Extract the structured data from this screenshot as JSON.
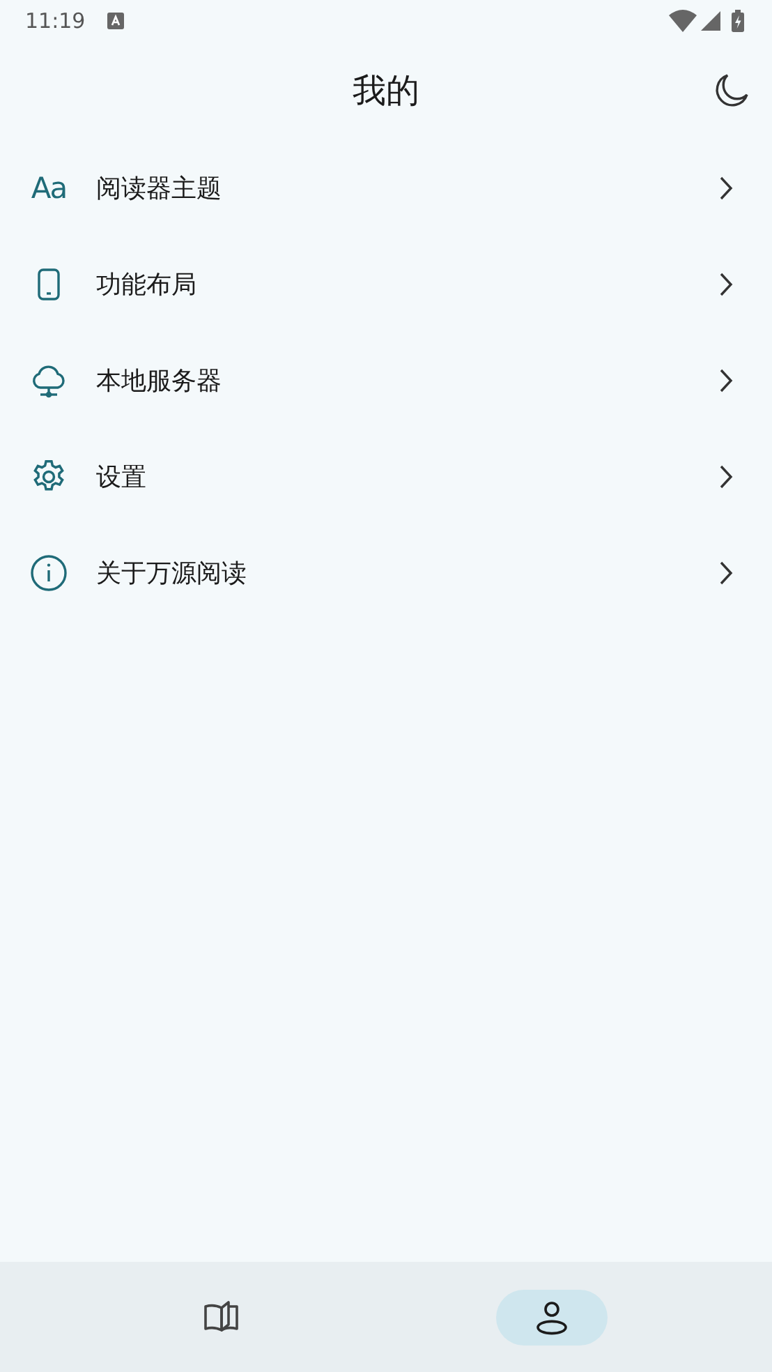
{
  "status_bar": {
    "time": "11:19"
  },
  "header": {
    "title": "我的"
  },
  "menu": [
    {
      "kind": "font",
      "glyph": "Aa",
      "label": "阅读器主题"
    },
    {
      "kind": "phone",
      "label": "功能布局"
    },
    {
      "kind": "cloud",
      "label": "本地服务器"
    },
    {
      "kind": "gear",
      "label": "设置"
    },
    {
      "kind": "info",
      "label": "关于万源阅读"
    }
  ],
  "bottom_nav": [
    {
      "kind": "book",
      "selected": false
    },
    {
      "kind": "person",
      "selected": true
    }
  ]
}
